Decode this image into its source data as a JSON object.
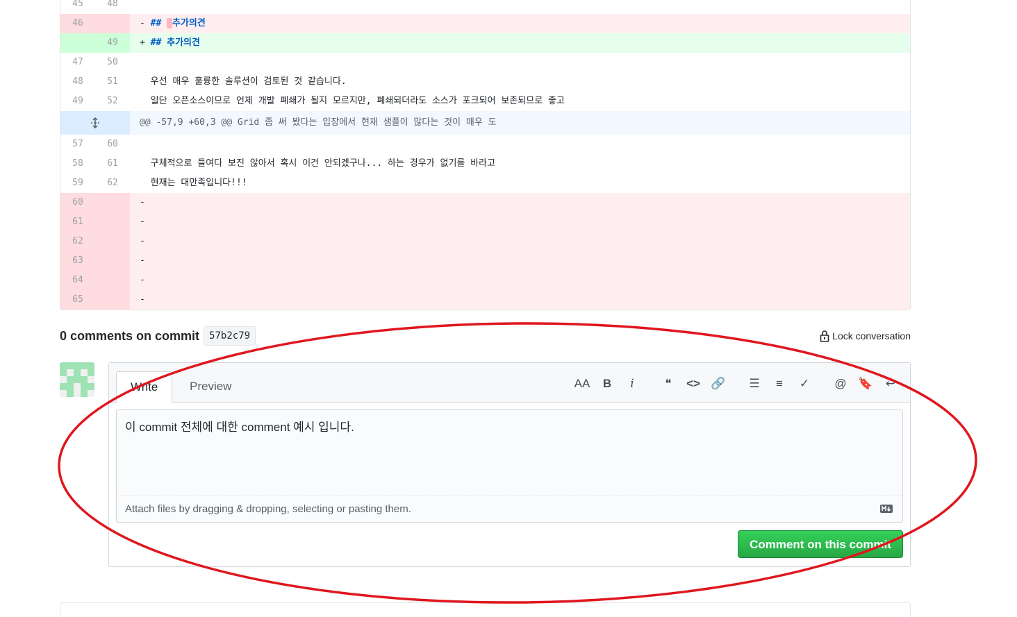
{
  "diff": {
    "rows": [
      {
        "type": "ctx",
        "old": "45",
        "new": "48",
        "text": ""
      },
      {
        "type": "del",
        "old": "46",
        "new": "",
        "sign": "-",
        "text": "## ",
        "highlight": " ",
        "rest": "추가의견"
      },
      {
        "type": "add",
        "old": "",
        "new": "49",
        "sign": "+",
        "text": "## 추가의견"
      },
      {
        "type": "ctx",
        "old": "47",
        "new": "50",
        "text": ""
      },
      {
        "type": "ctx",
        "old": "48",
        "new": "51",
        "text": "우선 매우 훌륭한 솔루션이 검토된 것 같습니다."
      },
      {
        "type": "ctx",
        "old": "49",
        "new": "52",
        "text": "일단 오픈소스이므로 언제 개발 폐쇄가 될지 모르지만, 폐쇄되더라도 소스가 포크되어 보존되므로 좋고"
      },
      {
        "type": "hunk",
        "text": "@@ -57,9 +60,3 @@ Grid 좀 써 봤다는 입장에서 현재 샘플이 많다는 것이 매우 도"
      },
      {
        "type": "ctx",
        "old": "57",
        "new": "60",
        "text": ""
      },
      {
        "type": "ctx",
        "old": "58",
        "new": "61",
        "text": "구체적으로 들여다 보진 않아서 혹시 이건 안되겠구나... 하는 경우가 없기를 바라고"
      },
      {
        "type": "ctx",
        "old": "59",
        "new": "62",
        "text": "현재는 대만족입니다!!!"
      },
      {
        "type": "del",
        "old": "60",
        "new": "",
        "sign": "-",
        "text": ""
      },
      {
        "type": "del",
        "old": "61",
        "new": "",
        "sign": "-",
        "text": ""
      },
      {
        "type": "del",
        "old": "62",
        "new": "",
        "sign": "-",
        "text": ""
      },
      {
        "type": "del",
        "old": "63",
        "new": "",
        "sign": "-",
        "text": ""
      },
      {
        "type": "del",
        "old": "64",
        "new": "",
        "sign": "-",
        "text": ""
      },
      {
        "type": "del",
        "old": "65",
        "new": "",
        "sign": "-",
        "text": ""
      }
    ],
    "expand_icon": "unfold-icon"
  },
  "comments": {
    "title": "0 comments on commit",
    "sha": "57b2c79",
    "lock_label": "Lock conversation"
  },
  "editor": {
    "tabs": [
      "Write",
      "Preview"
    ],
    "toolbar": [
      {
        "name": "text-size-icon",
        "glyph": "AA"
      },
      {
        "name": "bold-icon",
        "glyph": "B"
      },
      {
        "name": "italic-icon",
        "glyph": "i"
      },
      {
        "name": "quote-icon",
        "glyph": "❝"
      },
      {
        "name": "code-icon",
        "glyph": "<>"
      },
      {
        "name": "link-icon",
        "glyph": "🔗"
      },
      {
        "name": "bulleted-list-icon",
        "glyph": "☰"
      },
      {
        "name": "numbered-list-icon",
        "glyph": "≡"
      },
      {
        "name": "task-list-icon",
        "glyph": "✓"
      },
      {
        "name": "mention-icon",
        "glyph": "@"
      },
      {
        "name": "saved-reply-icon",
        "glyph": "🔖"
      },
      {
        "name": "reply-icon",
        "glyph": "↩"
      }
    ],
    "value": "이 commit 전체에 대한 comment 예시 입니다.",
    "attach_hint": "Attach files by dragging & dropping, selecting or pasting them.",
    "markdown_icon": "markdown-icon",
    "submit_label": "Comment on this commit"
  },
  "colors": {
    "annotation": "#e0161e",
    "submit": "#2ea44f",
    "del_bg": "#ffeef0",
    "add_bg": "#e6ffed"
  }
}
